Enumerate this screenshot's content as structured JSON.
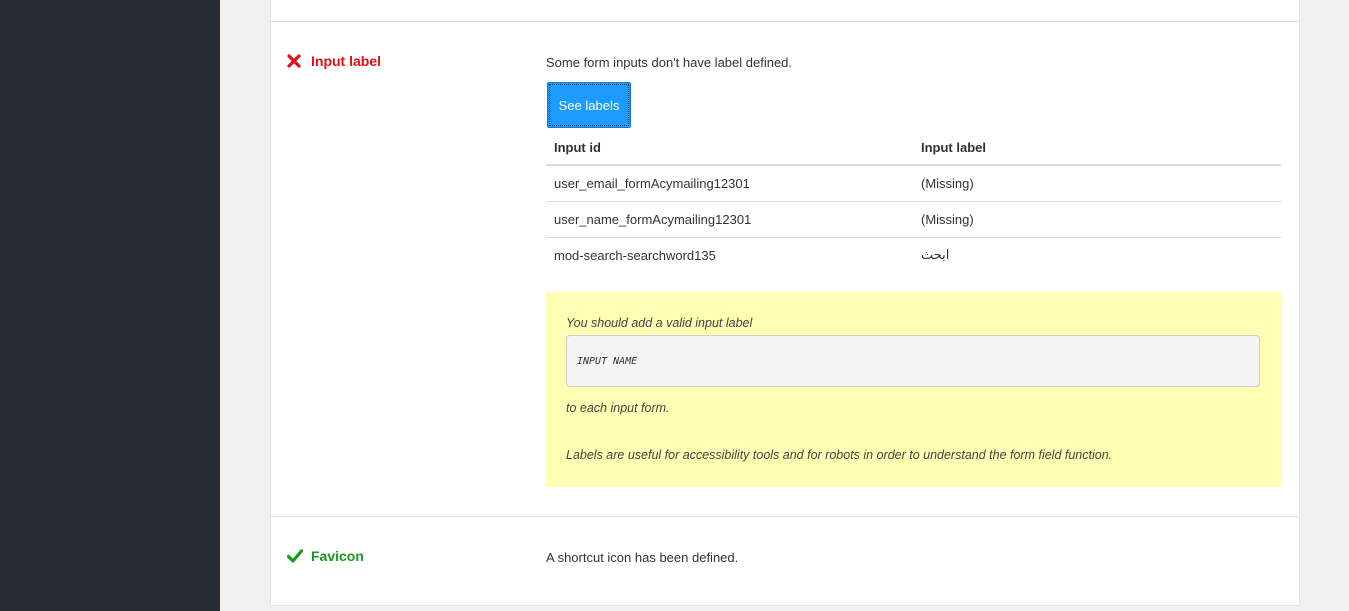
{
  "input_label_section": {
    "title": "Input label",
    "status": "fail",
    "icon": "x-mark-icon",
    "message": "Some form inputs don't have label defined.",
    "button_label": "See labels",
    "table": {
      "headers": [
        "Input id",
        "Input label"
      ],
      "rows": [
        [
          "user_email_formAcymailing12301",
          "(Missing)"
        ],
        [
          "user_name_formAcymailing12301",
          "(Missing)"
        ],
        [
          "mod-search-searchword135",
          "ابحث"
        ]
      ]
    },
    "advice": {
      "line1": "You should add a valid input label",
      "code": "INPUT NAME",
      "line2": "to each input form.",
      "line3": "Labels are useful for accessibility tools and for robots in order to understand the form field function."
    }
  },
  "favicon_section": {
    "title": "Favicon",
    "status": "pass",
    "icon": "check-mark-icon",
    "message": "A shortcut icon has been defined."
  },
  "colors": {
    "sidebar": "#272b33",
    "fail": "#e10f0f",
    "pass": "#1a9a1a",
    "button": "#1e9bff",
    "advice_background": "#ffffb3"
  }
}
